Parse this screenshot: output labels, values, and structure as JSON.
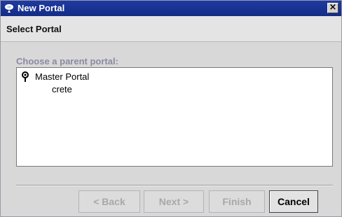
{
  "window": {
    "title": "New Portal",
    "icon": "portal-pin-icon",
    "close_label": "×"
  },
  "step": {
    "title": "Select Portal",
    "prompt": "Choose a parent portal:"
  },
  "tree": {
    "root": {
      "label": "Master Portal",
      "icon": "pin-icon"
    },
    "children": [
      {
        "label": "crete"
      }
    ]
  },
  "buttons": {
    "back": "< Back",
    "next": "Next >",
    "finish": "Finish",
    "cancel": "Cancel"
  },
  "colors": {
    "titlebar": "#1f3aa0",
    "dialog_bg": "#d8d8d8",
    "prompt_text": "#8a8aa2",
    "disabled_text": "#a8a8a8"
  }
}
